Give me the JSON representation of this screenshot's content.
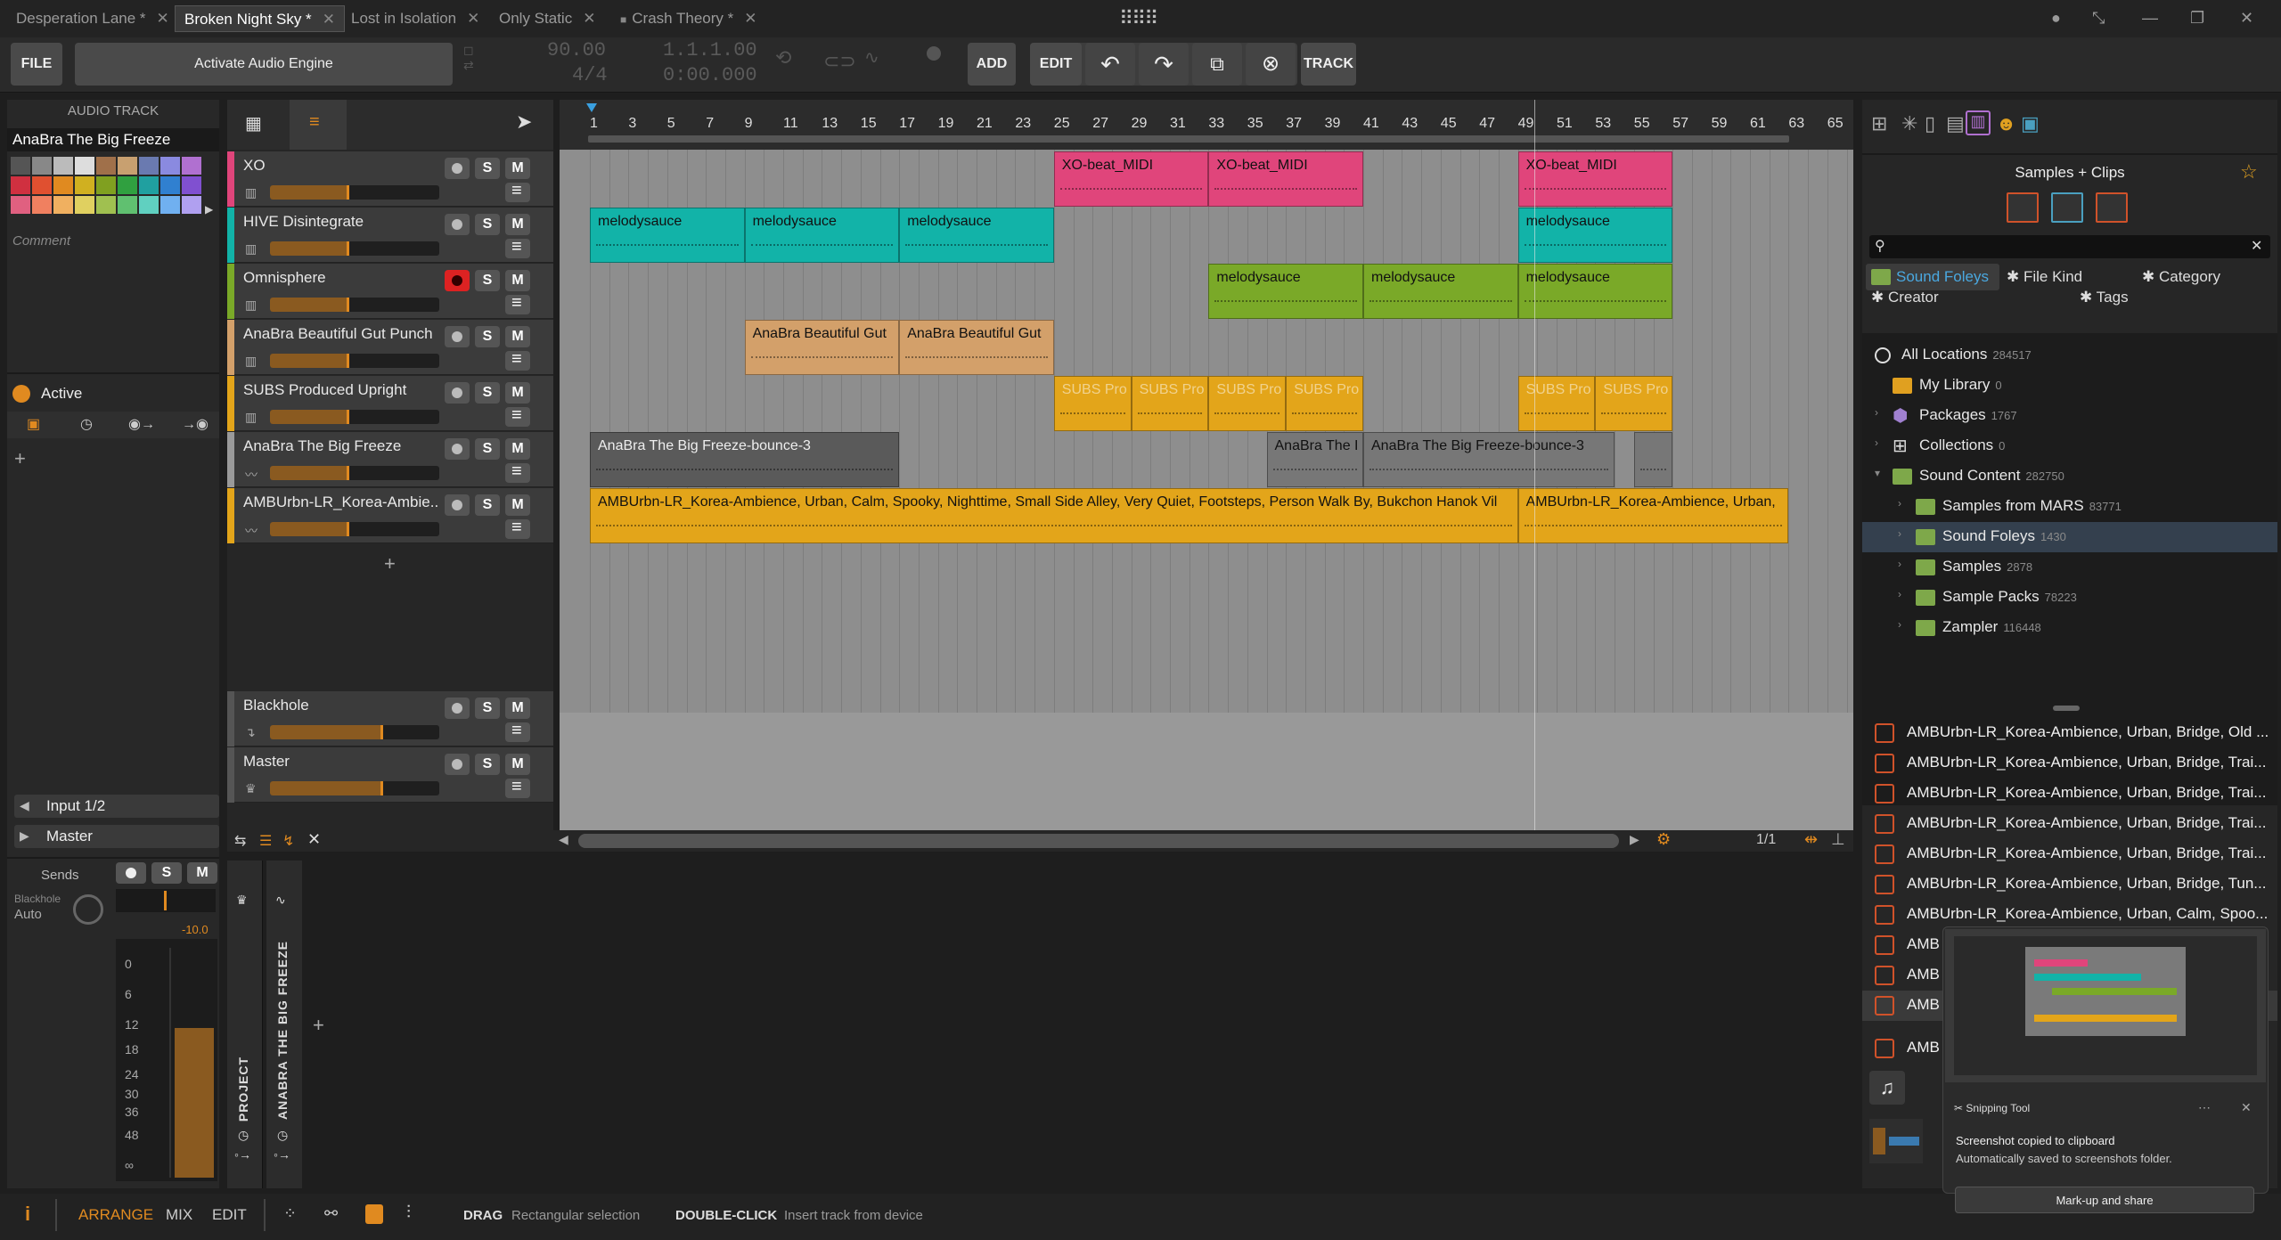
{
  "doc_tabs": [
    {
      "label": "Desperation Lane *"
    },
    {
      "label": "Broken Night Sky *"
    },
    {
      "label": "Lost in Isolation"
    },
    {
      "label": "Only Static"
    },
    {
      "label": "Crash Theory *"
    }
  ],
  "transport": {
    "file": "FILE",
    "activate": "Activate Audio Engine",
    "tempo": "90.00",
    "time_sig": "4/4",
    "position": "1.1.1.00",
    "time": "0:00.000",
    "add": "ADD",
    "edit": "EDIT",
    "track": "TRACK"
  },
  "inspector": {
    "header": "AUDIO TRACK",
    "track_name": "AnaBra The Big Freeze",
    "comment": "Comment",
    "active": "Active",
    "input": "Input 1/2",
    "output": "Master",
    "sends": "Sends",
    "send_target": "Blackhole",
    "send_mode": "Auto",
    "peak": "-10.0",
    "meter_scale": [
      "0",
      "6",
      "12",
      "18",
      "24",
      "30",
      "36",
      "48",
      "∞"
    ]
  },
  "tracks": [
    {
      "name": "XO",
      "color": "#e0457b",
      "vol": 0.45,
      "armed": false
    },
    {
      "name": "HIVE Disintegrate",
      "color": "#12b3a8",
      "vol": 0.45,
      "armed": false
    },
    {
      "name": "Omnisphere",
      "color": "#7aa928",
      "vol": 0.45,
      "armed": true
    },
    {
      "name": "AnaBra Beautiful Gut Punch",
      "color": "#d3a06a",
      "vol": 0.45,
      "armed": false
    },
    {
      "name": "SUBS Produced Upright",
      "color": "#e3a51a",
      "vol": 0.45,
      "armed": false
    },
    {
      "name": "AnaBra The Big Freeze",
      "color": "#9a9a9a",
      "vol": 0.45,
      "armed": false
    },
    {
      "name": "AMBUrbn-LR_Korea-Ambie...",
      "color": "#e3a51a",
      "vol": 0.45,
      "armed": false
    }
  ],
  "fx_tracks": [
    {
      "name": "Blackhole",
      "vol": 0.65
    },
    {
      "name": "Master",
      "vol": 0.65
    }
  ],
  "ruler": [
    "1",
    "3",
    "5",
    "7",
    "9",
    "11",
    "13",
    "15",
    "17",
    "19",
    "21",
    "23",
    "25",
    "27",
    "29",
    "31",
    "33",
    "35",
    "37",
    "39",
    "41",
    "43",
    "45",
    "47",
    "49",
    "51",
    "53",
    "55",
    "57",
    "59",
    "61",
    "63",
    "65"
  ],
  "clips": {
    "xo": "XO-beat_MIDI",
    "melody": "melodysauce",
    "gut": "AnaBra Beautiful Gut",
    "subs": "SUBS Pro",
    "freeze": "AnaBra The Big Freeze-bounce-3",
    "freeze_short": "AnaBra The I",
    "amb": "AMBUrbn-LR_Korea-Ambience, Urban, Calm, Spooky, Nighttime, Small Side Alley, Very Quiet, Footsteps, Person Walk By, Bukchon Hanok Vil",
    "amb2": "AMBUrbn-LR_Korea-Ambience, Urban,"
  },
  "zoom": "1/1",
  "lower": {
    "project": "PROJECT",
    "track": "ANABRA THE BIG FREEZE"
  },
  "browser": {
    "title": "Samples + Clips",
    "filters": [
      "Sound Foleys",
      "File Kind",
      "Category",
      "Creator",
      "Tags"
    ],
    "locations": [
      {
        "label": "All Locations",
        "count": "284517"
      },
      {
        "label": "My Library",
        "count": "0"
      },
      {
        "label": "Packages",
        "count": "1767"
      },
      {
        "label": "Collections",
        "count": "0"
      },
      {
        "label": "Sound Content",
        "count": "282750"
      },
      {
        "label": "Samples from MARS",
        "count": "83771"
      },
      {
        "label": "Sound Foleys",
        "count": "1430"
      },
      {
        "label": "Samples",
        "count": "2878"
      },
      {
        "label": "Sample Packs",
        "count": "78223"
      },
      {
        "label": "Zampler",
        "count": "116448"
      }
    ],
    "files": [
      "AMBUrbn-LR_Korea-Ambience, Urban, Bridge, Old ...",
      "AMBUrbn-LR_Korea-Ambience, Urban, Bridge, Trai...",
      "AMBUrbn-LR_Korea-Ambience, Urban, Bridge, Trai...",
      "AMBUrbn-LR_Korea-Ambience, Urban, Bridge, Trai...",
      "AMBUrbn-LR_Korea-Ambience, Urban, Bridge, Trai...",
      "AMBUrbn-LR_Korea-Ambience, Urban, Bridge, Tun...",
      "AMBUrbn-LR_Korea-Ambience, Urban, Calm, Spoo...",
      "AMB",
      "AMB",
      "AMB",
      "AMB"
    ]
  },
  "snip": {
    "app": "Snipping Tool",
    "line1": "Screenshot copied to clipboard",
    "line2": "Automatically saved to screenshots folder.",
    "action": "Mark-up and share"
  },
  "status": {
    "arrange": "ARRANGE",
    "mix": "MIX",
    "edit": "EDIT",
    "drag_key": "DRAG",
    "drag_desc": "Rectangular selection",
    "dbl_key": "DOUBLE-CLICK",
    "dbl_desc": "Insert track from device"
  },
  "colors": {
    "accent": "#e08a20",
    "pink": "#e0457b",
    "teal": "#12b3a8",
    "green": "#7aa928",
    "tan": "#d3a06a",
    "gold": "#e3a51a"
  }
}
